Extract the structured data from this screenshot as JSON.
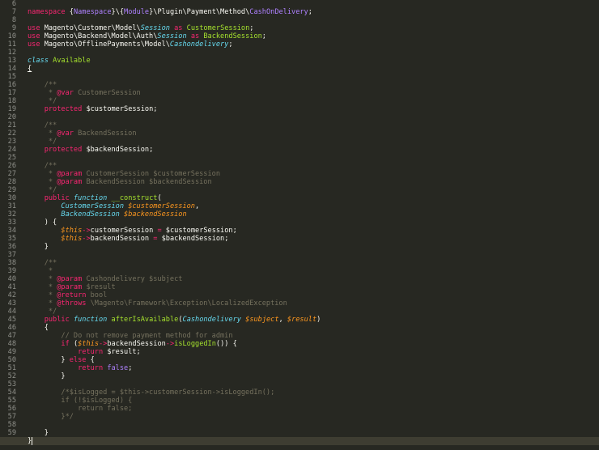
{
  "editor": {
    "theme": {
      "background": "#272822",
      "foreground": "#f8f8f2",
      "gutter_fg": "#8f908a",
      "current_line_bg": "#3e3d32"
    },
    "current_line": 60,
    "lines": [
      {
        "n": "6",
        "t": []
      },
      {
        "n": "7",
        "t": [
          [
            "namespace",
            "k"
          ],
          [
            " {",
            ""
          ],
          [
            "Namespace",
            "c"
          ],
          [
            "}\\{",
            ""
          ],
          [
            "Module",
            "c"
          ],
          [
            "}\\Plugin\\Payment\\Method\\",
            ""
          ],
          [
            "CashOnDelivery",
            "c"
          ],
          [
            ";",
            ""
          ]
        ]
      },
      {
        "n": "8",
        "t": []
      },
      {
        "n": "9",
        "t": [
          [
            "use",
            "k"
          ],
          [
            " Magento\\Customer\\Model\\",
            ""
          ],
          [
            "Session",
            "ti"
          ],
          [
            " ",
            ""
          ],
          [
            "as",
            "k"
          ],
          [
            " ",
            ""
          ],
          [
            "CustomerSession",
            "e"
          ],
          [
            ";",
            ""
          ]
        ]
      },
      {
        "n": "10",
        "t": [
          [
            "use",
            "k"
          ],
          [
            " Magento\\Backend\\Model\\Auth\\",
            ""
          ],
          [
            "Session",
            "ti"
          ],
          [
            " ",
            ""
          ],
          [
            "as",
            "k"
          ],
          [
            " ",
            ""
          ],
          [
            "BackendSession",
            "e"
          ],
          [
            ";",
            ""
          ]
        ]
      },
      {
        "n": "11",
        "t": [
          [
            "use",
            "k"
          ],
          [
            " Magento\\OfflinePayments\\Model\\",
            ""
          ],
          [
            "Cashondelivery",
            "ti"
          ],
          [
            ";",
            ""
          ]
        ]
      },
      {
        "n": "12",
        "t": []
      },
      {
        "n": "13",
        "t": [
          [
            "class",
            "si"
          ],
          [
            " ",
            ""
          ],
          [
            "Available",
            "e"
          ]
        ]
      },
      {
        "n": "14",
        "t": [
          [
            "{",
            "u"
          ]
        ]
      },
      {
        "n": "15",
        "t": []
      },
      {
        "n": "16",
        "t": [
          [
            "    /**",
            "cm"
          ]
        ]
      },
      {
        "n": "17",
        "t": [
          [
            "     * ",
            "cm"
          ],
          [
            "@var",
            "k"
          ],
          [
            " CustomerSession",
            "cm"
          ]
        ]
      },
      {
        "n": "18",
        "t": [
          [
            "     */",
            "cm"
          ]
        ]
      },
      {
        "n": "19",
        "t": [
          [
            "    ",
            ""
          ],
          [
            "protected",
            "k"
          ],
          [
            " $customerSession;",
            ""
          ]
        ]
      },
      {
        "n": "20",
        "t": []
      },
      {
        "n": "21",
        "t": [
          [
            "    /**",
            "cm"
          ]
        ]
      },
      {
        "n": "22",
        "t": [
          [
            "     * ",
            "cm"
          ],
          [
            "@var",
            "k"
          ],
          [
            " BackendSession",
            "cm"
          ]
        ]
      },
      {
        "n": "23",
        "t": [
          [
            "     */",
            "cm"
          ]
        ]
      },
      {
        "n": "24",
        "t": [
          [
            "    ",
            ""
          ],
          [
            "protected",
            "k"
          ],
          [
            " $backendSession;",
            ""
          ]
        ]
      },
      {
        "n": "25",
        "t": []
      },
      {
        "n": "26",
        "t": [
          [
            "    /**",
            "cm"
          ]
        ]
      },
      {
        "n": "27",
        "t": [
          [
            "     * ",
            "cm"
          ],
          [
            "@param",
            "k"
          ],
          [
            " CustomerSession $customerSession",
            "cm"
          ]
        ]
      },
      {
        "n": "28",
        "t": [
          [
            "     * ",
            "cm"
          ],
          [
            "@param",
            "k"
          ],
          [
            " BackendSession $backendSession",
            "cm"
          ]
        ]
      },
      {
        "n": "29",
        "t": [
          [
            "     */",
            "cm"
          ]
        ]
      },
      {
        "n": "30",
        "t": [
          [
            "    ",
            ""
          ],
          [
            "public",
            "k"
          ],
          [
            " ",
            ""
          ],
          [
            "function",
            "si"
          ],
          [
            " ",
            ""
          ],
          [
            "__construct",
            "g"
          ],
          [
            "(",
            ""
          ]
        ]
      },
      {
        "n": "31",
        "t": [
          [
            "        ",
            ""
          ],
          [
            "CustomerSession",
            "ti"
          ],
          [
            " ",
            ""
          ],
          [
            "$customerSession",
            "p"
          ],
          [
            ",",
            ""
          ]
        ]
      },
      {
        "n": "32",
        "t": [
          [
            "        ",
            ""
          ],
          [
            "BackendSession",
            "ti"
          ],
          [
            " ",
            ""
          ],
          [
            "$backendSession",
            "p"
          ]
        ]
      },
      {
        "n": "33",
        "t": [
          [
            "    ) {",
            ""
          ]
        ]
      },
      {
        "n": "34",
        "t": [
          [
            "        ",
            ""
          ],
          [
            "$this",
            "p"
          ],
          [
            "->",
            "k"
          ],
          [
            "customerSession ",
            ""
          ],
          [
            "=",
            "k"
          ],
          [
            " $customerSession;",
            ""
          ]
        ]
      },
      {
        "n": "35",
        "t": [
          [
            "        ",
            ""
          ],
          [
            "$this",
            "p"
          ],
          [
            "->",
            "k"
          ],
          [
            "backendSession ",
            ""
          ],
          [
            "=",
            "k"
          ],
          [
            " $backendSession;",
            ""
          ]
        ]
      },
      {
        "n": "36",
        "t": [
          [
            "    }",
            ""
          ]
        ]
      },
      {
        "n": "37",
        "t": []
      },
      {
        "n": "38",
        "t": [
          [
            "    /**",
            "cm"
          ]
        ]
      },
      {
        "n": "39",
        "t": [
          [
            "     *",
            "cm"
          ]
        ]
      },
      {
        "n": "40",
        "t": [
          [
            "     * ",
            "cm"
          ],
          [
            "@param",
            "k"
          ],
          [
            " Cashondelivery $subject",
            "cm"
          ]
        ]
      },
      {
        "n": "41",
        "t": [
          [
            "     * ",
            "cm"
          ],
          [
            "@param",
            "k"
          ],
          [
            " $result",
            "cm"
          ]
        ]
      },
      {
        "n": "42",
        "t": [
          [
            "     * ",
            "cm"
          ],
          [
            "@return",
            "k"
          ],
          [
            " bool",
            "cm"
          ]
        ]
      },
      {
        "n": "43",
        "t": [
          [
            "     * ",
            "cm"
          ],
          [
            "@throws",
            "k"
          ],
          [
            " \\Magento\\Framework\\Exception\\LocalizedException",
            "cm"
          ]
        ]
      },
      {
        "n": "44",
        "t": [
          [
            "     */",
            "cm"
          ]
        ]
      },
      {
        "n": "45",
        "t": [
          [
            "    ",
            ""
          ],
          [
            "public",
            "k"
          ],
          [
            " ",
            ""
          ],
          [
            "function",
            "si"
          ],
          [
            " ",
            ""
          ],
          [
            "afterIsAvailable",
            "g"
          ],
          [
            "(",
            ""
          ],
          [
            "Cashondelivery",
            "ti"
          ],
          [
            " ",
            ""
          ],
          [
            "$subject",
            "p"
          ],
          [
            ", ",
            ""
          ],
          [
            "$result",
            "p"
          ],
          [
            ")",
            ""
          ]
        ]
      },
      {
        "n": "46",
        "t": [
          [
            "    {",
            ""
          ]
        ]
      },
      {
        "n": "47",
        "t": [
          [
            "        // Do not remove payment method for admin",
            "cm"
          ]
        ]
      },
      {
        "n": "48",
        "t": [
          [
            "        ",
            ""
          ],
          [
            "if",
            "k"
          ],
          [
            " (",
            ""
          ],
          [
            "$this",
            "p"
          ],
          [
            "->",
            "k"
          ],
          [
            "backendSession",
            ""
          ],
          [
            "->",
            "k"
          ],
          [
            "isLoggedIn",
            "g"
          ],
          [
            "()) {",
            ""
          ]
        ]
      },
      {
        "n": "49",
        "t": [
          [
            "            ",
            ""
          ],
          [
            "return",
            "k"
          ],
          [
            " $result;",
            ""
          ]
        ]
      },
      {
        "n": "50",
        "t": [
          [
            "        } ",
            ""
          ],
          [
            "else",
            "k"
          ],
          [
            " {",
            ""
          ]
        ]
      },
      {
        "n": "51",
        "t": [
          [
            "            ",
            ""
          ],
          [
            "return",
            "k"
          ],
          [
            " ",
            ""
          ],
          [
            "false",
            "c"
          ],
          [
            ";",
            ""
          ]
        ]
      },
      {
        "n": "52",
        "t": [
          [
            "        }",
            ""
          ]
        ]
      },
      {
        "n": "53",
        "t": []
      },
      {
        "n": "54",
        "t": [
          [
            "        /*$isLogged = $this->customerSession->isLoggedIn();",
            "cm"
          ]
        ]
      },
      {
        "n": "55",
        "t": [
          [
            "        if (!$isLogged) {",
            "cm"
          ]
        ]
      },
      {
        "n": "56",
        "t": [
          [
            "            return false;",
            "cm"
          ]
        ]
      },
      {
        "n": "57",
        "t": [
          [
            "        }*/",
            "cm"
          ]
        ]
      },
      {
        "n": "58",
        "t": []
      },
      {
        "n": "59",
        "t": [
          [
            "    }",
            ""
          ]
        ]
      },
      {
        "n": "60",
        "t": [
          [
            "}",
            ""
          ]
        ]
      }
    ]
  }
}
